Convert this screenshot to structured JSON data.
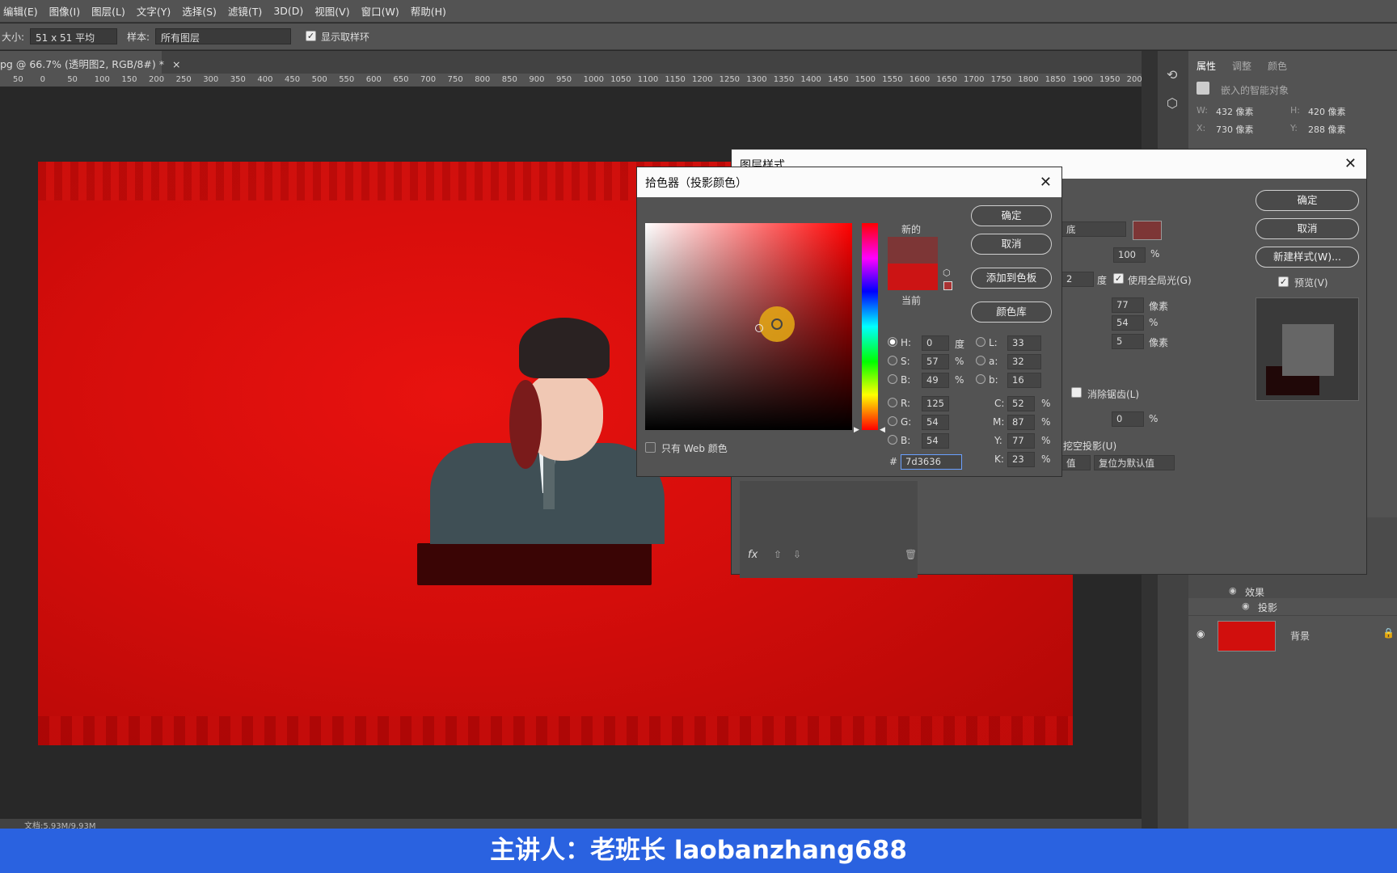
{
  "menu": [
    "编辑(E)",
    "图像(I)",
    "图层(L)",
    "文字(Y)",
    "选择(S)",
    "滤镜(T)",
    "3D(D)",
    "视图(V)",
    "窗口(W)",
    "帮助(H)"
  ],
  "options": {
    "size_label": "大小:",
    "size_value": "51 x 51 平均",
    "sample_label": "样本:",
    "sample_value": "所有图层",
    "show_ring": "显示取样环"
  },
  "doc_tab": "pg @ 66.7% (透明图2, RGB/8#) *",
  "ruler": [
    "50",
    "0",
    "50",
    "100",
    "150",
    "200",
    "250",
    "300",
    "350",
    "400",
    "450",
    "500",
    "550",
    "600",
    "650",
    "700",
    "750",
    "800",
    "850",
    "900",
    "950",
    "1000",
    "1050",
    "1100",
    "1150",
    "1200",
    "1250",
    "1300",
    "1350",
    "1400",
    "1450",
    "1500",
    "1550",
    "1600",
    "1650",
    "1700",
    "1750",
    "1800",
    "1850",
    "1900",
    "1950",
    "2000"
  ],
  "status": "文档:5.93M/9.93M",
  "properties": {
    "tabs": [
      "属性",
      "调整",
      "颜色"
    ],
    "smart_object": "嵌入的智能对象",
    "w_label": "W:",
    "w": "432 像素",
    "h_label": "H:",
    "h": "420 像素",
    "x_label": "X:",
    "x": "730 像素",
    "y_label": "Y:",
    "y": "288 像素"
  },
  "layers": {
    "effects": "效果",
    "drop_shadow": "投影",
    "background": "背景"
  },
  "layer_style": {
    "title": "图层样式",
    "ok": "确定",
    "cancel": "取消",
    "new_style": "新建样式(W)...",
    "preview": "预览(V)",
    "blend_mode": "底",
    "opacity": "100",
    "angle": "2",
    "angle_unit": "度",
    "global_light": "使用全局光(G)",
    "distance": "77",
    "spread": "54",
    "size": "5",
    "px": "像素",
    "pct": "%",
    "anti_alias": "消除锯齿(L)",
    "noise": "0",
    "knockout": "挖空投影(U)",
    "set_default": "值",
    "reset_default": "复位为默认值"
  },
  "color_picker": {
    "title": "拾色器（投影颜色）",
    "ok": "确定",
    "cancel": "取消",
    "add_swatch": "添加到色板",
    "color_libs": "颜色库",
    "new_label": "新的",
    "current_label": "当前",
    "web_only": "只有 Web 颜色",
    "H": "0",
    "S": "57",
    "B": "49",
    "R": "125",
    "G": "54",
    "Bv": "54",
    "L": "33",
    "a": "32",
    "b": "16",
    "C": "52",
    "M": "87",
    "Y": "77",
    "K": "23",
    "hex": "7d3636",
    "deg": "度",
    "pct": "%",
    "new_color": "#7d3636",
    "current_color": "#cc1414"
  },
  "banner": "主讲人：老班长 laobanzhang688"
}
